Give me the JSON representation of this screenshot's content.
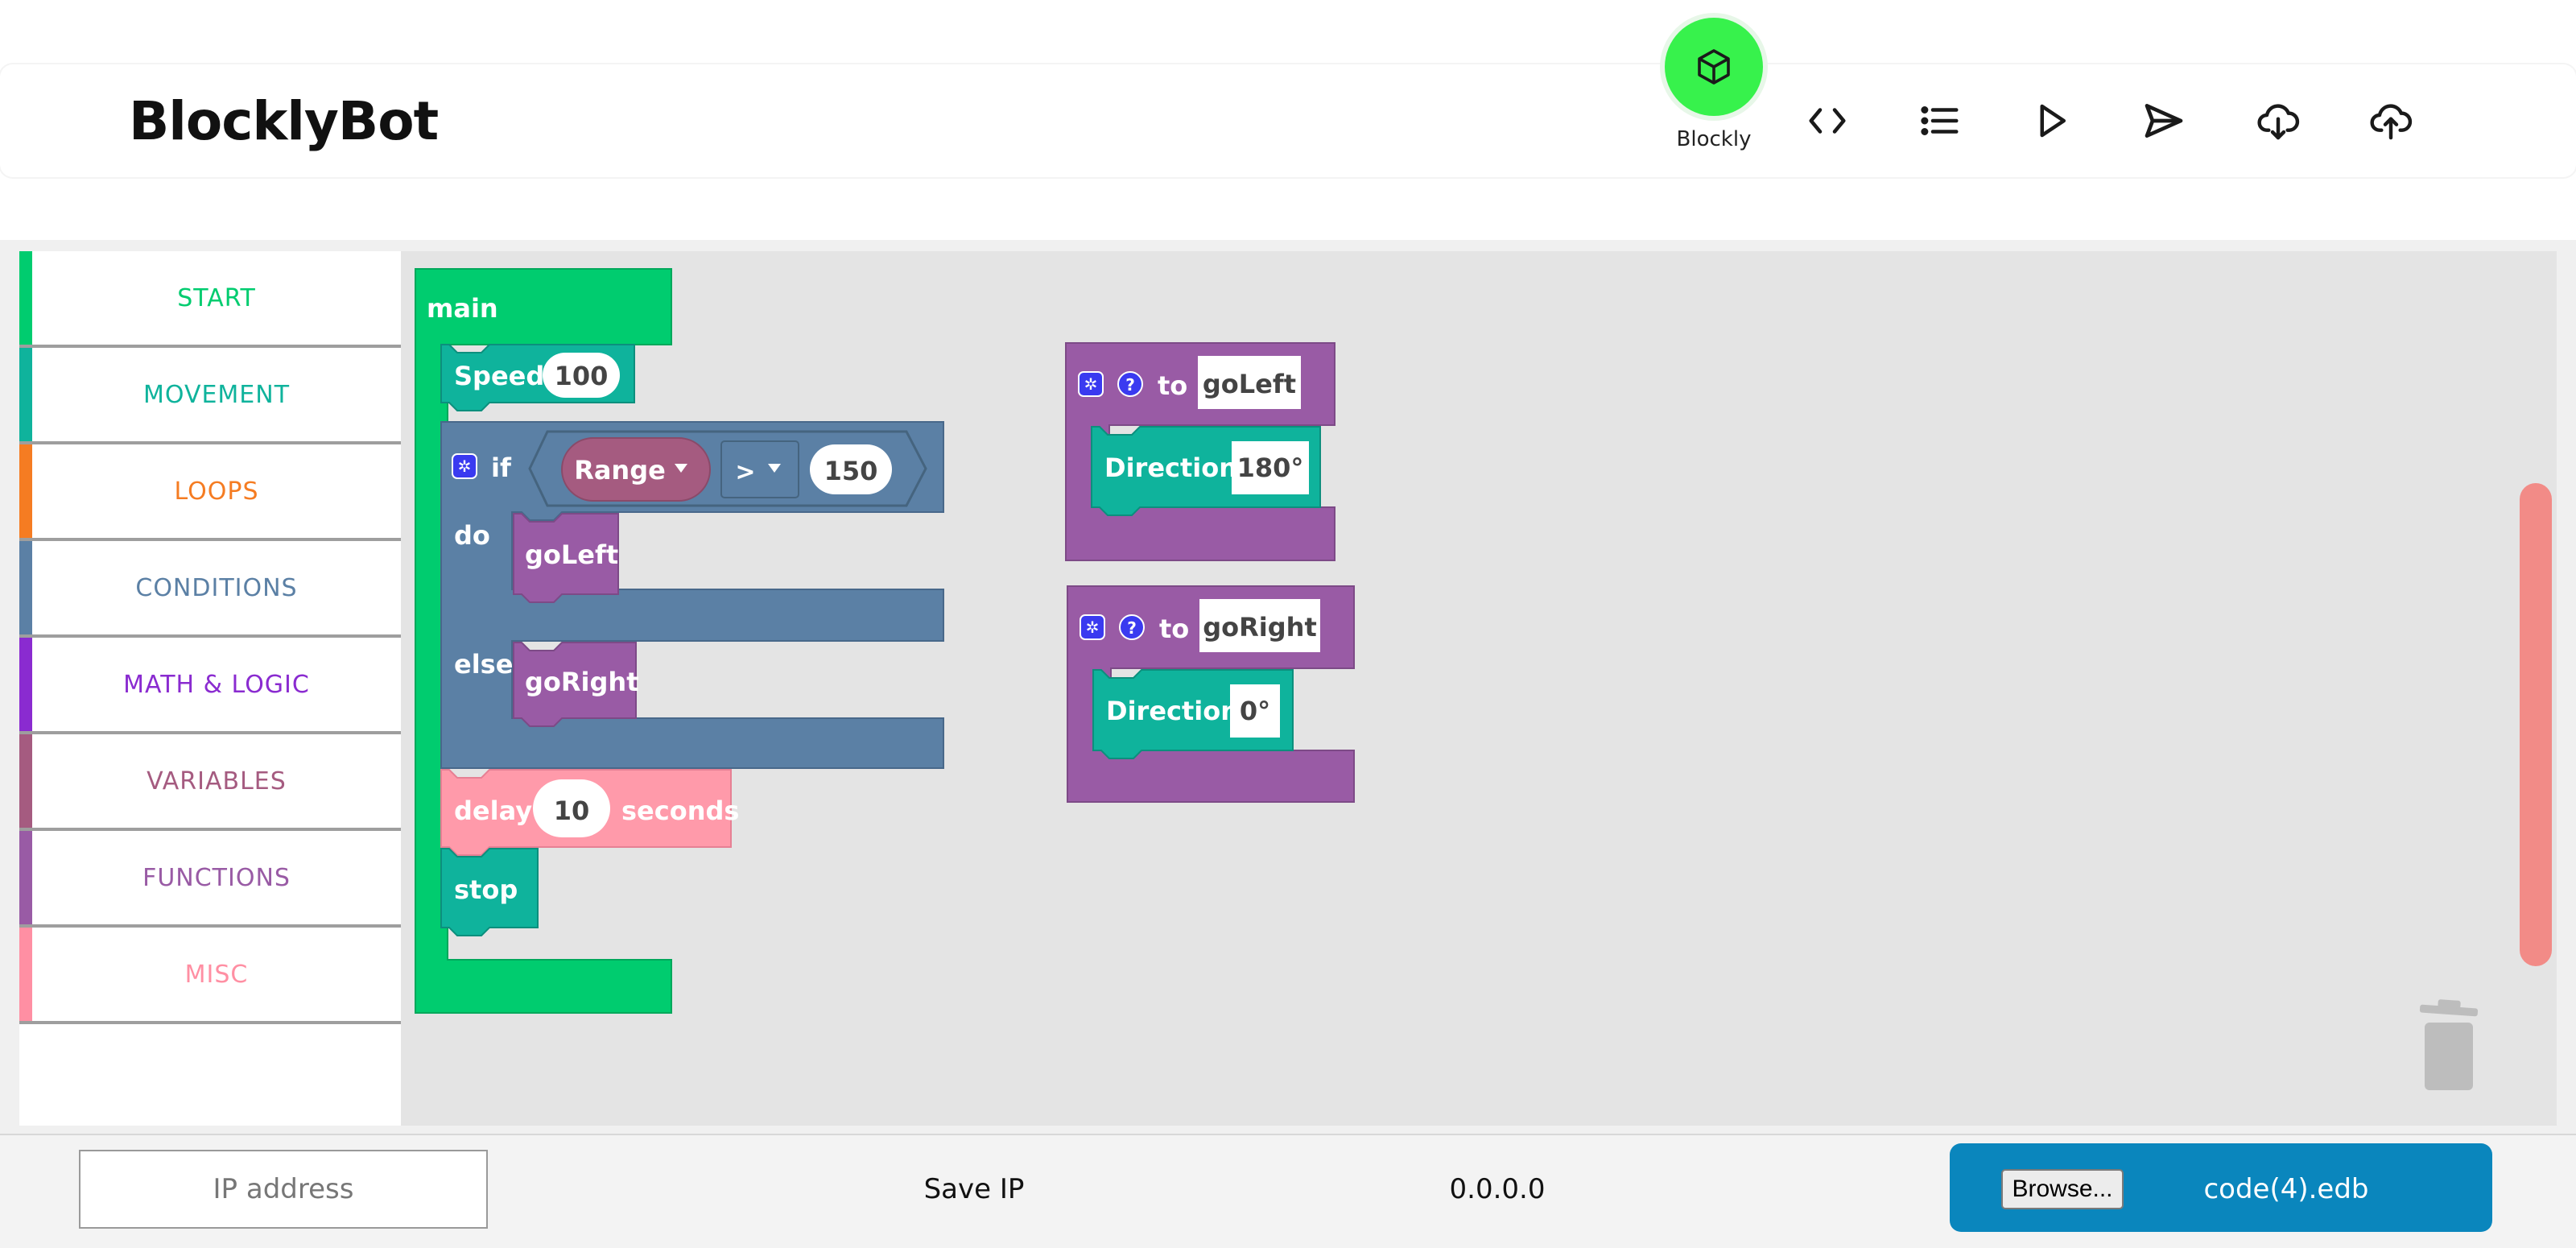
{
  "app": {
    "title": "BlocklyBot"
  },
  "toolbar": {
    "active_label": "Blockly",
    "icons": [
      "cube-icon",
      "code-icon",
      "list-icon",
      "play-icon",
      "send-icon",
      "cloud-download-icon",
      "cloud-upload-icon"
    ]
  },
  "sidebar": {
    "categories": [
      {
        "label": "START",
        "color": "#00cc6f"
      },
      {
        "label": "MOVEMENT",
        "color": "#0fb39c"
      },
      {
        "label": "LOOPS",
        "color": "#f57c22"
      },
      {
        "label": "CONDITIONS",
        "color": "#5b80a5"
      },
      {
        "label": "MATH & LOGIC",
        "color": "#8a2bd0"
      },
      {
        "label": "VARIABLES",
        "color": "#a55b80"
      },
      {
        "label": "FUNCTIONS",
        "color": "#995ba5"
      },
      {
        "label": "MISC",
        "color": "#ff8fa3"
      }
    ]
  },
  "workspace": {
    "main_block": {
      "label": "main",
      "speed": {
        "label": "Speed",
        "value": "100"
      },
      "if_block": {
        "if_label": "if",
        "sensor": "Range",
        "operator": ">",
        "threshold": "150",
        "do_label": "do",
        "do_call": "goLeft",
        "else_label": "else",
        "else_call": "goRight"
      },
      "delay": {
        "label": "delay",
        "value": "10",
        "unit": "seconds"
      },
      "stop": "stop"
    },
    "functions": [
      {
        "to": "to",
        "name": "goLeft",
        "direction_label": "Direction",
        "direction_value": "180°"
      },
      {
        "to": "to",
        "name": "goRight",
        "direction_label": "Direction",
        "direction_value": "0°"
      }
    ]
  },
  "footer": {
    "ip_placeholder": "IP address",
    "save_label": "Save IP",
    "ip_value": "0.0.0.0",
    "browse_label": "Browse...",
    "file_name": "code(4).edb"
  },
  "colors": {
    "start": "#00cc6f",
    "movement": "#0fb39c",
    "conditions": "#5b80a5",
    "functions": "#995ba5",
    "variables": "#a55b80",
    "misc": "#ff8fa3",
    "accent": "#37f24c",
    "file_panel": "#0a86bd"
  }
}
